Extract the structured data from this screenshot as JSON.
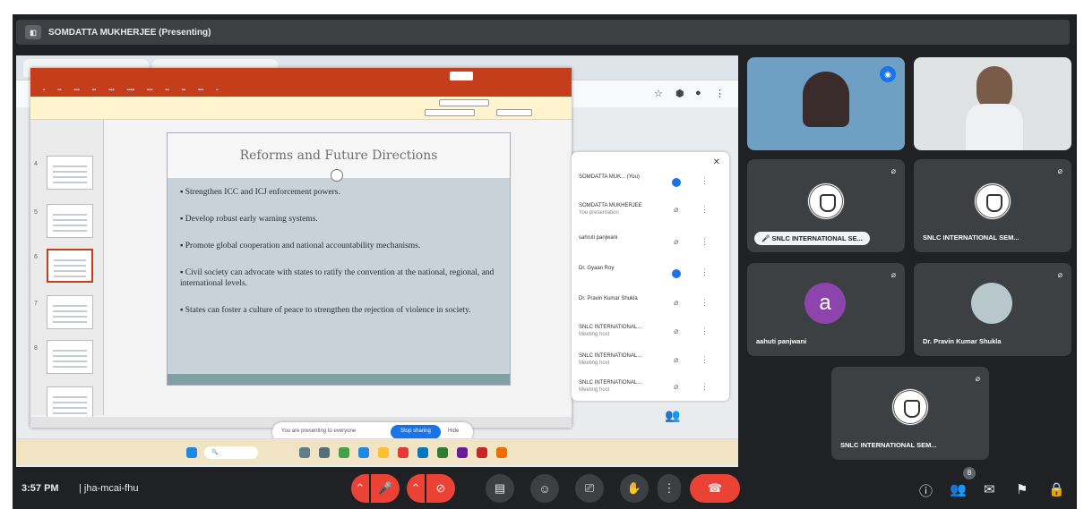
{
  "header": {
    "title": "SOMDATTA MUKHERJEE (Presenting)"
  },
  "slide": {
    "title": "Reforms and Future Directions",
    "bullets": [
      "Strengthen ICC and ICJ enforcement powers.",
      "Develop robust early warning systems.",
      "Promote global cooperation and national accountability mechanisms.",
      "Civil society can advocate with states to ratify the convention at the national, regional, and international levels.",
      "States can foster a culture of peace to strengthen the rejection of violence in society."
    ]
  },
  "share_bar": {
    "text": "You are presenting to everyone",
    "stop_label": "Stop sharing",
    "hide_label": "Hide"
  },
  "participants_panel": {
    "rows": [
      {
        "name": "SOMDATTA MUK... (You)"
      },
      {
        "name": "SOMDATTA MUKHERJEE",
        "sub": "You presentation"
      },
      {
        "name": "sahruti panjwani"
      },
      {
        "name": "Dr. Gyaan Roy"
      },
      {
        "name": "Dr. Pravin Kumar Shukla"
      },
      {
        "name": "SNLC INTERNATIONAL...",
        "sub": "Meeting host"
      },
      {
        "name": "SNLC INTERNATIONAL...",
        "sub": "Meeting host"
      },
      {
        "name": "SNLC INTERNATIONAL...",
        "sub": "Meeting host"
      }
    ]
  },
  "tiles": {
    "t3_name": "SNLC INTERNATIONAL SE...",
    "t4_name": "SNLC INTERNATIONAL SEM...",
    "t5_avatar": "a",
    "t5_name": "aahuti panjwani",
    "t6_name": "Dr. Pravin Kumar Shukla",
    "t7_name": "SNLC INTERNATIONAL SEM..."
  },
  "bottom": {
    "time": "3:57 PM",
    "code": "jha-mcai-fhu",
    "people_count": "8"
  },
  "colors": {
    "meet_bg": "#202124",
    "tile_bg": "#3c4043",
    "ppt_red": "#c43e1c",
    "end_call": "#ea4335",
    "accent_blue": "#1a73e8"
  }
}
